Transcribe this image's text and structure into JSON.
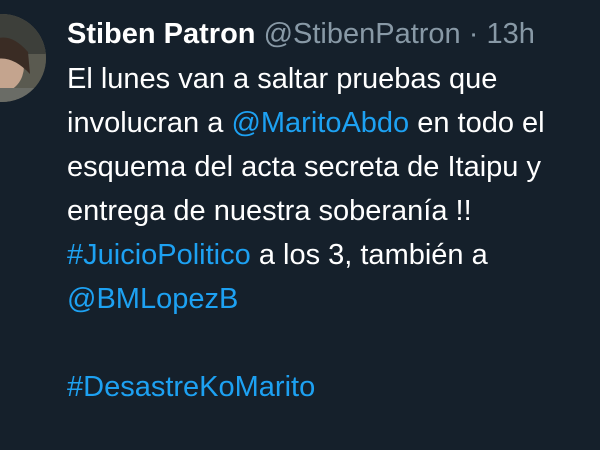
{
  "tweet": {
    "author_name": "Stiben Patron",
    "author_handle": "@StibenPatron",
    "separator": "·",
    "time": "13h",
    "lines": {
      "l1": "El lunes van a saltar pruebas que",
      "l2_pre": "involucran a ",
      "l2_mention": "@MaritoAbdo",
      "l2_post": " en todo el",
      "l3": "esquema del acta secreta de Itaipu y",
      "l4": "entrega de nuestra soberanía !!",
      "l5_hashtag": "#JuicioPolitico",
      "l5_post": " a los 3, también a",
      "l6_mention": "@BMLopezB",
      "l8_hashtag": "#DesastreKoMarito"
    }
  },
  "colors": {
    "background": "#15202b",
    "link": "#1da1f2",
    "secondary_text": "#8899a6"
  }
}
